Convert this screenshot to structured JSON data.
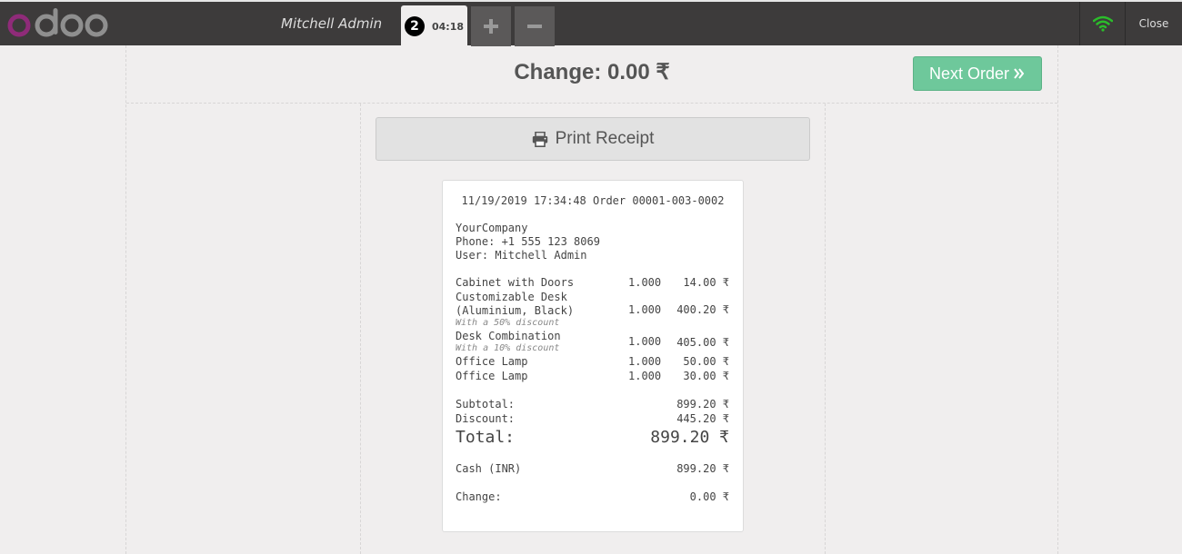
{
  "topbar": {
    "username": "Mitchell Admin",
    "order_tab": {
      "number": "2",
      "time": "04:18"
    },
    "close_label": "Close"
  },
  "header": {
    "change_label": "Change: 0.00 ₹",
    "next_order_label": "Next Order"
  },
  "print_receipt_label": "Print Receipt",
  "receipt": {
    "header_line": "11/19/2019 17:34:48 Order 00001-003-0002",
    "company": "YourCompany",
    "phone": "Phone: +1 555 123 8069",
    "user": "User: Mitchell Admin",
    "lines": [
      {
        "name": "Cabinet with Doors",
        "qty": "1.000",
        "price": "14.00 ₹"
      },
      {
        "name": "Customizable Desk",
        "name2": "(Aluminium, Black)",
        "note": "With a 50% discount",
        "qty": "1.000",
        "price": "400.20 ₹"
      },
      {
        "name": "Desk Combination",
        "note": "With a 10% discount",
        "qty": "1.000",
        "price": "405.00 ₹"
      },
      {
        "name": "Office Lamp",
        "qty": "1.000",
        "price": "50.00 ₹"
      },
      {
        "name": "Office Lamp",
        "qty": "1.000",
        "price": "30.00 ₹"
      }
    ],
    "subtotal_label": "Subtotal:",
    "subtotal_value": "899.20 ₹",
    "discount_label": "Discount:",
    "discount_value": "445.20 ₹",
    "total_label": "Total:",
    "total_value": "899.20 ₹",
    "payment_label": "Cash (INR)",
    "payment_value": "899.20 ₹",
    "change_label": "Change:",
    "change_value": "0.00 ₹"
  },
  "colors": {
    "topbar": "#3d3b3b",
    "logo_accent": "#8f2b79",
    "next_order": "#6ec89b",
    "wifi": "#2bbd2b"
  },
  "icons": {
    "logo": "odoo-logo",
    "plus": "plus-icon",
    "minus": "minus-icon",
    "wifi": "wifi-icon",
    "print": "print-icon",
    "next": "double-chevron-right-icon"
  }
}
